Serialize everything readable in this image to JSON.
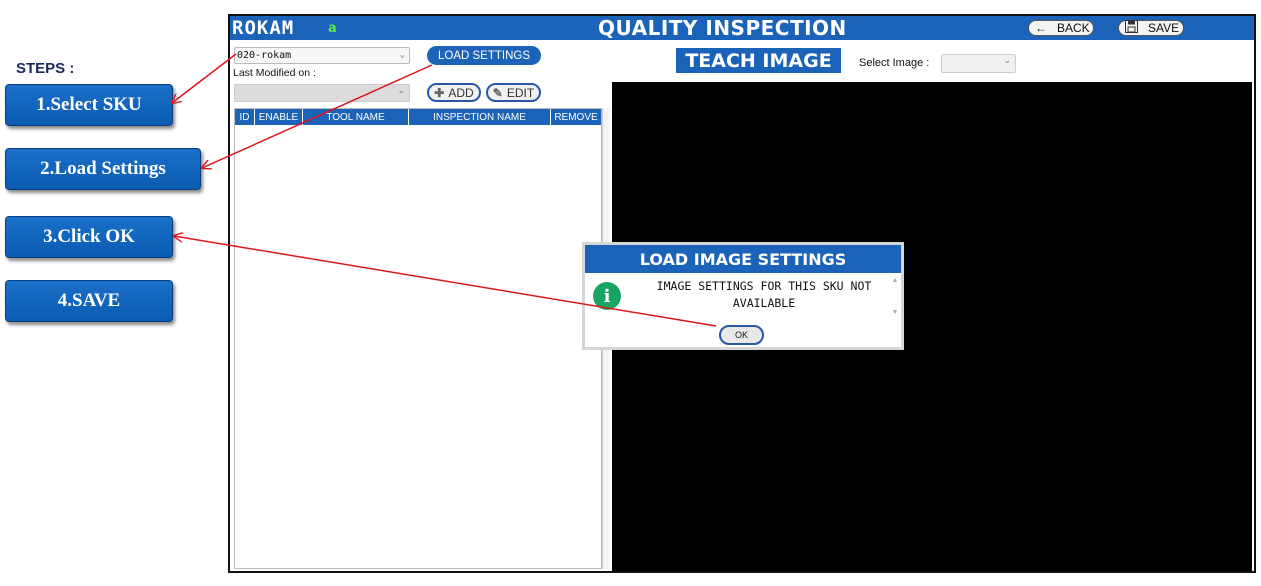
{
  "steps": {
    "title": "STEPS :",
    "items": [
      {
        "label": "1.Select  SKU"
      },
      {
        "label": "2.Load Settings"
      },
      {
        "label": "3.Click  OK"
      },
      {
        "label": "4.SAVE"
      }
    ]
  },
  "app": {
    "logo": "ROKAM",
    "logo_sub": "a",
    "title": "QUALITY INSPECTION",
    "back_label": "BACK",
    "save_label": "SAVE",
    "back_icon": "arrow-left-icon",
    "save_icon": "floppy-icon"
  },
  "left_panel": {
    "sku_value": "020-rokam",
    "last_modified_label": "Last Modified on :",
    "load_settings_label": "LOAD SETTINGS",
    "add_label": "ADD",
    "edit_label": "EDIT",
    "table_headers": [
      "ID",
      "ENABLE",
      "TOOL NAME",
      "INSPECTION NAME",
      "REMOVE"
    ]
  },
  "right_panel": {
    "teach_title": "TEACH IMAGE",
    "select_image_label": "Select Image :"
  },
  "dialog": {
    "title": "LOAD IMAGE SETTINGS",
    "message_line1": "IMAGE SETTINGS FOR THIS SKU NOT",
    "message_line2": "AVAILABLE",
    "ok_label": "OK",
    "icon": "info-icon"
  },
  "colors": {
    "brand_blue": "#1b63b8",
    "annotation_red": "#e0141b",
    "info_green": "#17a55f"
  }
}
